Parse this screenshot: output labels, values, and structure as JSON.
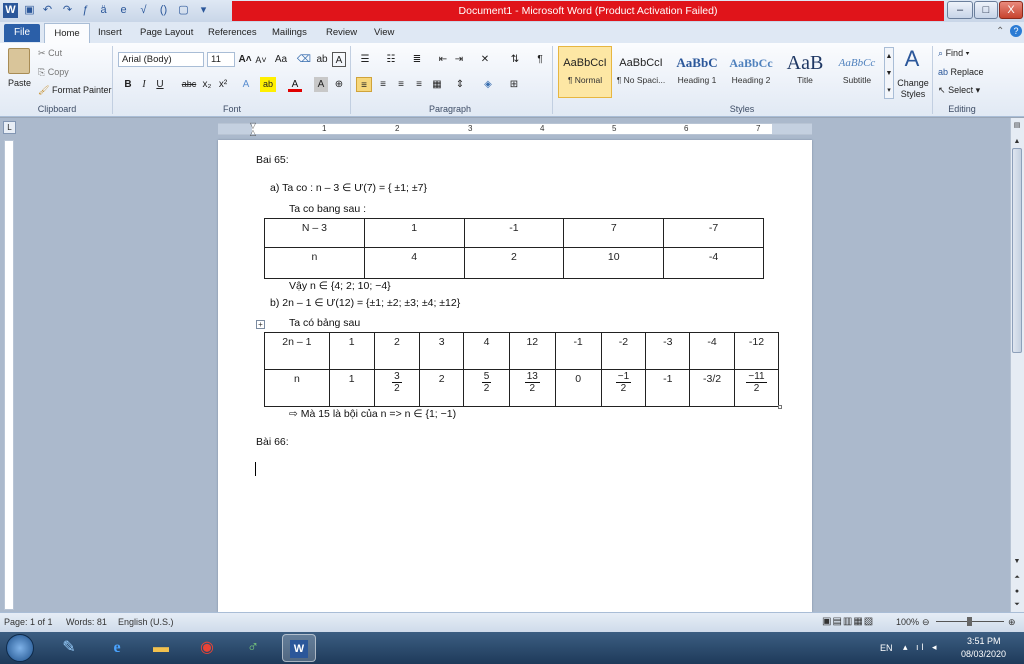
{
  "window": {
    "title": "Document1 - Microsoft Word (Product Activation Failed)",
    "minimize": "–",
    "maximize": "□",
    "close": "X"
  },
  "tabs": [
    "File",
    "Home",
    "Insert",
    "Page Layout",
    "References",
    "Mailings",
    "Review",
    "View"
  ],
  "ribbon": {
    "clipboard": {
      "paste": "Paste",
      "cut": "Cut",
      "copy": "Copy",
      "format_painter": "Format Painter",
      "label": "Clipboard"
    },
    "font": {
      "name": "Arial (Body)",
      "size": "11",
      "label": "Font"
    },
    "paragraph": {
      "label": "Paragraph"
    },
    "styles": {
      "label": "Styles",
      "items": [
        {
          "preview": "AaBbCcI",
          "name": "¶ Normal"
        },
        {
          "preview": "AaBbCcI",
          "name": "¶ No Spaci..."
        },
        {
          "preview": "AaBbC",
          "name": "Heading 1"
        },
        {
          "preview": "AaBbCc",
          "name": "Heading 2"
        },
        {
          "preview": "AaB",
          "name": "Title"
        },
        {
          "preview": "AaBbCc",
          "name": "Subtitle"
        }
      ],
      "change_styles": "Change Styles"
    },
    "editing": {
      "find": "Find",
      "replace": "Replace",
      "select": "Select",
      "label": "Editing"
    }
  },
  "ruler": [
    "1",
    "2",
    "3",
    "4",
    "5",
    "6",
    "7"
  ],
  "doc": {
    "heading65": "Bai 65:",
    "a_line": "a)   Ta co : n – 3 ∈ Ư(7) = { ±1; ±7}",
    "a_table_intro": "Ta co bang sau :",
    "table1": {
      "row1": [
        "N – 3",
        "1",
        "-1",
        "7",
        "-7"
      ],
      "row2": [
        "n",
        "4",
        "2",
        "10",
        "-4"
      ]
    },
    "a_result": "Vậy n ∈ {4; 2; 10; −4}",
    "b_line": "b)   2n – 1 ∈ Ư(12) = {±1; ±2; ±3; ±4; ±12}",
    "b_table_intro": "Ta có bảng sau",
    "table2": {
      "row1": [
        "2n – 1",
        "1",
        "2",
        "3",
        "4",
        "12",
        "-1",
        "-2",
        "-3",
        "-4",
        "-12"
      ],
      "row2": [
        {
          "t": "n"
        },
        {
          "t": "1"
        },
        {
          "n": "3",
          "d": "2"
        },
        {
          "t": "2"
        },
        {
          "n": "5",
          "d": "2"
        },
        {
          "n": "13",
          "d": "2"
        },
        {
          "t": "0"
        },
        {
          "n": "−1",
          "d": "2"
        },
        {
          "t": "-1"
        },
        {
          "t": "-3/2"
        },
        {
          "n": "−11",
          "d": "2"
        }
      ]
    },
    "b_result": "⇨  Mà 15 là bội của n  => n ∈ {1; −1)",
    "heading66": "Bài 66:"
  },
  "status": {
    "page": "Page: 1 of 1",
    "words": "Words: 81",
    "lang": "English (U.S.)",
    "zoom": "100%"
  },
  "tray": {
    "lang": "EN",
    "time": "3:51 PM",
    "date": "08/03/2020"
  }
}
